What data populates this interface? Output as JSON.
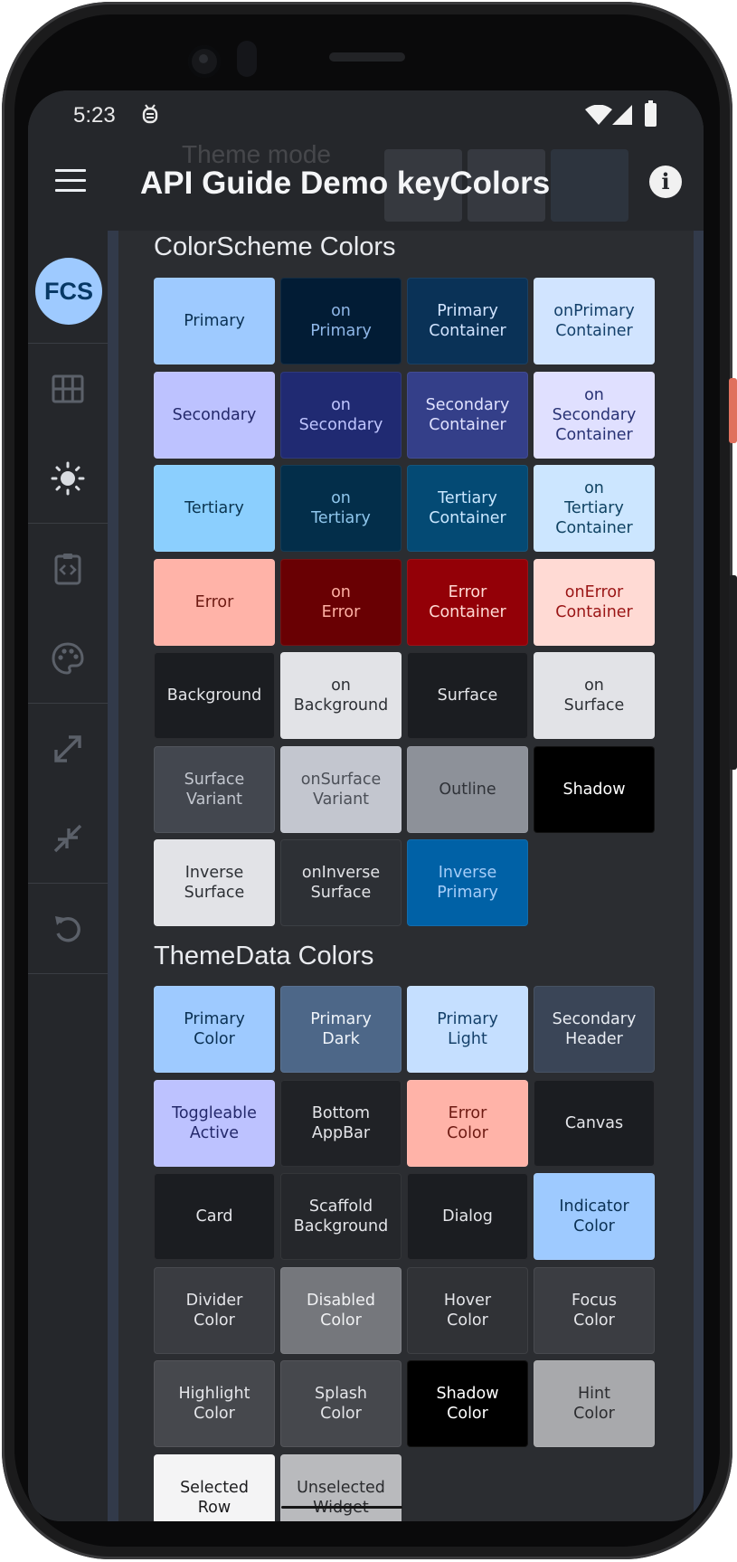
{
  "status_bar": {
    "time": "5:23"
  },
  "app_bar": {
    "title": "API Guide Demo keyColors",
    "ghost_label": "Theme mode"
  },
  "rail": {
    "avatar_label": "FCS"
  },
  "colorscheme": {
    "title": "ColorScheme Colors",
    "swatches": [
      {
        "label": "Primary",
        "bg": "#9ecaff",
        "fg": "#0b3154"
      },
      {
        "label": "on\nPrimary",
        "bg": "#021c35",
        "fg": "#8fb7e8"
      },
      {
        "label": "Primary\nContainer",
        "bg": "#0a3257",
        "fg": "#d2e4ff"
      },
      {
        "label": "onPrimary\nContainer",
        "bg": "#d1e4ff",
        "fg": "#14406a"
      },
      {
        "label": "Secondary",
        "bg": "#bdc2ff",
        "fg": "#23286a"
      },
      {
        "label": "on\nSecondary",
        "bg": "#202a72",
        "fg": "#c0c6ff"
      },
      {
        "label": "Secondary\nContainer",
        "bg": "#343f89",
        "fg": "#e0e2ff"
      },
      {
        "label": "on\nSecondary\nContainer",
        "bg": "#e0e0ff",
        "fg": "#283274"
      },
      {
        "label": "Tertiary",
        "bg": "#8bcffe",
        "fg": "#0b3550"
      },
      {
        "label": "on\nTertiary",
        "bg": "#032e4a",
        "fg": "#8fc6ec"
      },
      {
        "label": "Tertiary\nContainer",
        "bg": "#044a74",
        "fg": "#cae7ff"
      },
      {
        "label": "on\nTertiary\nContainer",
        "bg": "#cce6ff",
        "fg": "#0f4262"
      },
      {
        "label": "Error",
        "bg": "#ffb3a8",
        "fg": "#6d1a12"
      },
      {
        "label": "on\nError",
        "bg": "#690003",
        "fg": "#ffb0a4"
      },
      {
        "label": "Error\nContainer",
        "bg": "#930007",
        "fg": "#ffdad4"
      },
      {
        "label": "onError\nContainer",
        "bg": "#ffdad4",
        "fg": "#9a1515"
      },
      {
        "label": "Background",
        "bg": "#1b1d21",
        "fg": "#e4e5e9"
      },
      {
        "label": "on\nBackground",
        "bg": "#e2e3e7",
        "fg": "#2d3035"
      },
      {
        "label": "Surface",
        "bg": "#1b1d21",
        "fg": "#e4e5e9"
      },
      {
        "label": "on\nSurface",
        "bg": "#e2e3e7",
        "fg": "#2d3035"
      },
      {
        "label": "Surface\nVariant",
        "bg": "#43474f",
        "fg": "#c3c7cf"
      },
      {
        "label": "onSurface\nVariant",
        "bg": "#c3c6cf",
        "fg": "#4b4f57"
      },
      {
        "label": "Outline",
        "bg": "#8d9199",
        "fg": "#2f3238"
      },
      {
        "label": "Shadow",
        "bg": "#000000",
        "fg": "#ffffff"
      },
      {
        "label": "Inverse\nSurface",
        "bg": "#e2e3e7",
        "fg": "#2d3035"
      },
      {
        "label": "onInverse\nSurface",
        "bg": "#2d3035",
        "fg": "#e2e3e7"
      },
      {
        "label": "Inverse\nPrimary",
        "bg": "#0061a6",
        "fg": "#a5cdf8"
      }
    ]
  },
  "themedata": {
    "title": "ThemeData Colors",
    "swatches": [
      {
        "label": "Primary\nColor",
        "bg": "#9ecaff",
        "fg": "#0b3154"
      },
      {
        "label": "Primary\nDark",
        "bg": "#4d6788",
        "fg": "#eef3f9"
      },
      {
        "label": "Primary\nLight",
        "bg": "#c5dfff",
        "fg": "#14406a"
      },
      {
        "label": "Secondary\nHeader",
        "bg": "#3a4557",
        "fg": "#e8ecf2"
      },
      {
        "label": "Toggleable\nActive",
        "bg": "#bdc2ff",
        "fg": "#23286a"
      },
      {
        "label": "Bottom\nAppBar",
        "bg": "#202226",
        "fg": "#e4e5e9"
      },
      {
        "label": "Error\nColor",
        "bg": "#ffb3a8",
        "fg": "#6d1a12"
      },
      {
        "label": "Canvas",
        "bg": "#1b1d21",
        "fg": "#e4e5e9"
      },
      {
        "label": "Card",
        "bg": "#1b1d21",
        "fg": "#e4e5e9"
      },
      {
        "label": "Scaffold\nBackground",
        "bg": "#25272b",
        "fg": "#e4e5e9"
      },
      {
        "label": "Dialog",
        "bg": "#1b1d21",
        "fg": "#e4e5e9"
      },
      {
        "label": "Indicator\nColor",
        "bg": "#9ecaff",
        "fg": "#0b3154"
      },
      {
        "label": "Divider\nColor",
        "bg": "#3a3c41",
        "fg": "#e4e5e9"
      },
      {
        "label": "Disabled\nColor",
        "bg": "#75777c",
        "fg": "#f0f1f3"
      },
      {
        "label": "Hover\nColor",
        "bg": "#303236",
        "fg": "#e4e5e9"
      },
      {
        "label": "Focus\nColor",
        "bg": "#3b3d42",
        "fg": "#e4e5e9"
      },
      {
        "label": "Highlight\nColor",
        "bg": "#46484d",
        "fg": "#e4e5e9"
      },
      {
        "label": "Splash\nColor",
        "bg": "#46484d",
        "fg": "#e4e5e9"
      },
      {
        "label": "Shadow\nColor",
        "bg": "#000000",
        "fg": "#ffffff"
      },
      {
        "label": "Hint\nColor",
        "bg": "#a8a9ac",
        "fg": "#2b2c2f"
      },
      {
        "label": "Selected\nRow",
        "bg": "#f4f4f5",
        "fg": "#1b1b1d"
      },
      {
        "label": "Unselected\nWidget",
        "bg": "#b9babd",
        "fg": "#2a2b2e"
      }
    ]
  }
}
